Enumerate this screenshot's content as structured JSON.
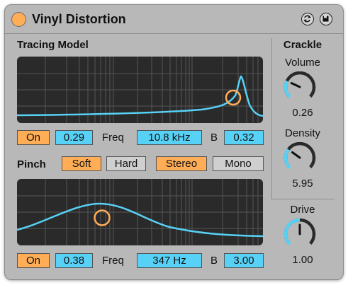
{
  "device": {
    "title": "Vinyl Distortion",
    "hotswap_icon": "hot-swap-icon",
    "save_icon": "save-preset-icon"
  },
  "tracing": {
    "label": "Tracing Model",
    "on_label": "On",
    "drywet": "0.29",
    "freq_label": "Freq",
    "freq": "10.8 kHz",
    "b_label": "B",
    "b": "0.32"
  },
  "pinch": {
    "label": "Pinch",
    "soft_label": "Soft",
    "hard_label": "Hard",
    "stereo_label": "Stereo",
    "mono_label": "Mono",
    "on_label": "On",
    "drywet": "0.38",
    "freq_label": "Freq",
    "freq": "347 Hz",
    "b_label": "B",
    "b": "3.00"
  },
  "crackle": {
    "label": "Crackle",
    "volume_label": "Volume",
    "volume": "0.26",
    "volume_level": 0.26,
    "density_label": "Density",
    "density": "5.95",
    "density_level": 0.3
  },
  "drive": {
    "label": "Drive",
    "value": "1.00",
    "level": 0.5
  },
  "colors": {
    "accent_orange": "#ffad56",
    "accent_blue": "#58d1f6",
    "panel": "#b8b8b8",
    "graph_bg": "#2a2a2a"
  }
}
